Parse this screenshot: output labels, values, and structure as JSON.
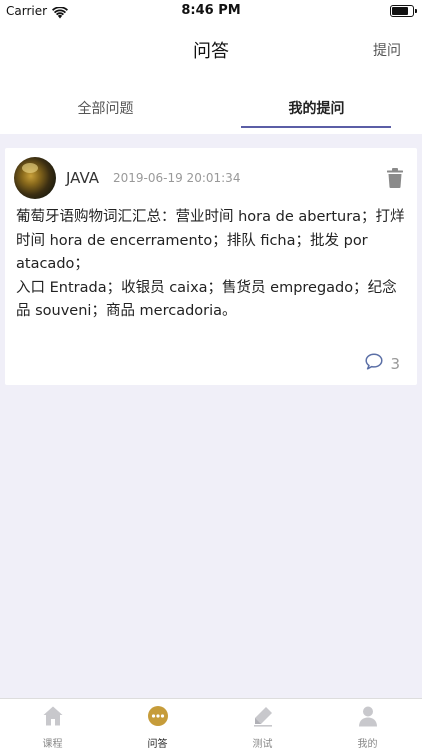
{
  "status_bar": {
    "carrier": "Carrier",
    "time": "8:46 PM"
  },
  "nav": {
    "title": "问答",
    "action_label": "提问"
  },
  "tabs": [
    {
      "label": "全部问题",
      "active": false
    },
    {
      "label": "我的提问",
      "active": true
    }
  ],
  "post": {
    "user": "JAVA",
    "time": "2019-06-19 20:01:34",
    "content": "葡萄牙语购物词汇汇总：营业时间 hora de abertura；打烊时间 hora de encerramento；排队 ficha；批发 por atacado；\n入口 Entrada；收银员 caixa；售货员 empregado；纪念品 souveni；商品 mercadoria。",
    "comment_count": "3"
  },
  "bottom_nav": [
    {
      "label": "课程",
      "icon": "home-icon",
      "active": false
    },
    {
      "label": "问答",
      "icon": "chat-bubble-icon",
      "active": true
    },
    {
      "label": "测试",
      "icon": "pen-test-icon",
      "active": false
    },
    {
      "label": "我的",
      "icon": "person-icon",
      "active": false
    }
  ],
  "colors": {
    "accent": "#5b5ea6",
    "active_tab_icon": "#c69c3a",
    "background": "#f0eff8"
  }
}
